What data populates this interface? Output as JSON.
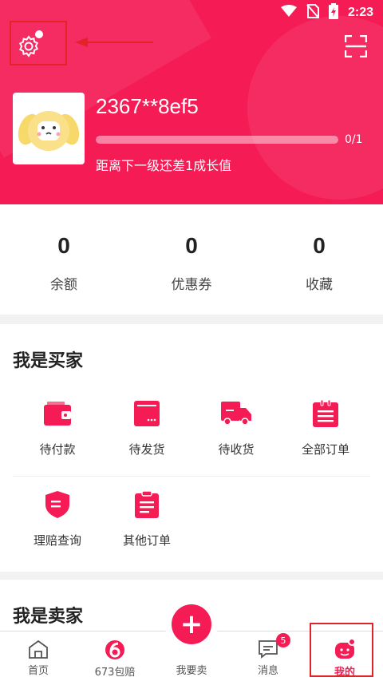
{
  "status_bar": {
    "time": "2:23"
  },
  "profile": {
    "username": "2367**8ef5",
    "progress_text": "0/1",
    "progress_fraction": 0.0,
    "level_hint": "距离下一级还差1成长值"
  },
  "stats": [
    {
      "value": "0",
      "label": "余额"
    },
    {
      "value": "0",
      "label": "优惠券"
    },
    {
      "value": "0",
      "label": "收藏"
    }
  ],
  "buyer": {
    "title": "我是买家",
    "items": [
      {
        "label": "待付款",
        "icon": "wallet-icon"
      },
      {
        "label": "待发货",
        "icon": "package-icon"
      },
      {
        "label": "待收货",
        "icon": "truck-icon"
      },
      {
        "label": "全部订单",
        "icon": "order-list-icon"
      },
      {
        "label": "理赔查询",
        "icon": "shield-icon"
      },
      {
        "label": "其他订单",
        "icon": "clipboard-icon"
      }
    ]
  },
  "seller": {
    "title": "我是卖家"
  },
  "bottom_nav": [
    {
      "label": "首页",
      "icon": "home-icon"
    },
    {
      "label": "673包赔",
      "icon": "brand-6-icon"
    },
    {
      "label": "我要卖",
      "icon": "plus-icon"
    },
    {
      "label": "消息",
      "icon": "message-icon",
      "badge": "5"
    },
    {
      "label": "我的",
      "icon": "profile-icon",
      "active": true
    }
  ],
  "colors": {
    "accent": "#f51b55",
    "highlight_frame": "#e3222a"
  }
}
